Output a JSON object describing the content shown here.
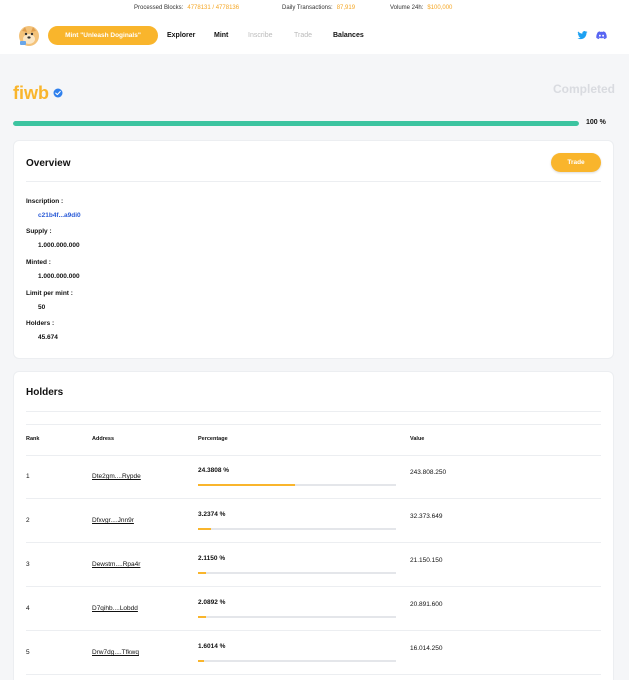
{
  "ticker": {
    "processed_label": "Processed Blocks:",
    "processed_value": "4778131 / 4778136",
    "daily_label": "Daily Transactions:",
    "daily_value": "87,919",
    "volume_label": "Volume 24h:",
    "volume_value": "$100,000"
  },
  "nav": {
    "mint_button": "Mint \"Unleash Doginals\"",
    "links": [
      "Explorer",
      "Mint",
      "Inscribe",
      "Trade",
      "Balances"
    ]
  },
  "token": {
    "name": "fiwb",
    "status": "Completed",
    "progress_percent": 100,
    "progress_label": "100 %"
  },
  "overview": {
    "title": "Overview",
    "trade_button": "Trade",
    "fields": [
      {
        "label": "Inscription :",
        "value": "c21b4f...a9di0"
      },
      {
        "label": "Supply :",
        "value": "1.000.000.000"
      },
      {
        "label": "Minted :",
        "value": "1.000.000.000"
      },
      {
        "label": "Limit per mint :",
        "value": "50"
      },
      {
        "label": "Holders :",
        "value": "45.674"
      }
    ]
  },
  "holders": {
    "title": "Holders",
    "columns": [
      "Rank",
      "Address",
      "Percentage",
      "Value"
    ],
    "rows": [
      {
        "rank": "1",
        "address": "Dte2gm....Rypde",
        "percentage": "24.3808 %",
        "pct": 24.3808,
        "value": "243.808.250"
      },
      {
        "rank": "2",
        "address": "Dfxvgr....Jnn9r",
        "percentage": "3.2374 %",
        "pct": 3.2374,
        "value": "32.373.649"
      },
      {
        "rank": "3",
        "address": "Dewstm....Rpa4r",
        "percentage": "2.1150 %",
        "pct": 2.115,
        "value": "21.150.150"
      },
      {
        "rank": "4",
        "address": "D7qihb....Lobdd",
        "percentage": "2.0892 %",
        "pct": 2.0892,
        "value": "20.891.600"
      },
      {
        "rank": "5",
        "address": "Drw7dg....Tfkwq",
        "percentage": "1.6014 %",
        "pct": 1.6014,
        "value": "16.014.250"
      }
    ]
  },
  "colors": {
    "accent": "#f9b52c",
    "progress": "#3cc4a0",
    "link": "#2a5bd7"
  },
  "icons": [
    "doge-logo-icon",
    "verified-badge-icon",
    "twitter-icon",
    "discord-icon"
  ]
}
